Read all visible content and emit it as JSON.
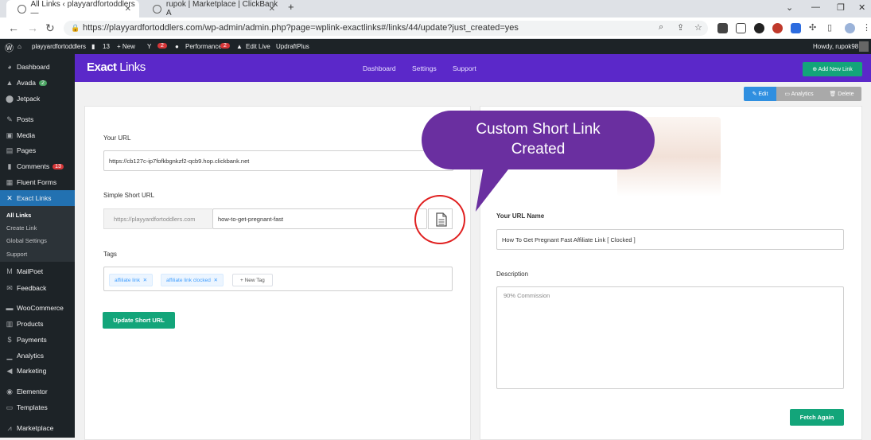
{
  "browser": {
    "tabs": [
      {
        "label": "All Links ‹ playyardfortoddlers —"
      },
      {
        "label": "rupok | Marketplace | ClickBank A"
      }
    ],
    "new_tab": "+",
    "url": "https://playyardfortoddlers.com/wp-admin/admin.php?page=wplink-exactlinks#/links/44/update?just_created=yes"
  },
  "wp_admin_bar": {
    "site": "playyardfortoddlers",
    "comments": "13",
    "new": "+ New",
    "yoast_badge": "2",
    "performance": "Performance",
    "performance_badge": "2",
    "edit_live": "Edit Live",
    "updraft": "UpdraftPlus",
    "howdy": "Howdy, rupok98"
  },
  "sidebar": {
    "items": [
      {
        "icon": "dashboard-icon",
        "label": "Dashboard"
      },
      {
        "icon": "avada-icon",
        "label": "Avada",
        "badge": "2"
      },
      {
        "icon": "jetpack-icon",
        "label": "Jetpack"
      },
      {
        "icon": "pin-icon",
        "label": "Posts"
      },
      {
        "icon": "media-icon",
        "label": "Media"
      },
      {
        "icon": "page-icon",
        "label": "Pages"
      },
      {
        "icon": "comments-icon",
        "label": "Comments",
        "badge": "13"
      },
      {
        "icon": "forms-icon",
        "label": "Fluent Forms"
      },
      {
        "icon": "link-icon",
        "label": "Exact Links"
      },
      {
        "icon": "mailpoet-icon",
        "label": "MailPoet"
      },
      {
        "icon": "feedback-icon",
        "label": "Feedback"
      },
      {
        "icon": "woocommerce-icon",
        "label": "WooCommerce"
      },
      {
        "icon": "products-icon",
        "label": "Products"
      },
      {
        "icon": "payments-icon",
        "label": "Payments"
      },
      {
        "icon": "analytics-icon",
        "label": "Analytics"
      },
      {
        "icon": "marketing-icon",
        "label": "Marketing"
      },
      {
        "icon": "elementor-icon",
        "label": "Elementor"
      },
      {
        "icon": "templates-icon",
        "label": "Templates"
      },
      {
        "icon": "marketplace-icon",
        "label": "Marketplace"
      }
    ],
    "submenu": [
      "All Links",
      "Create Link",
      "Global Settings",
      "Support"
    ]
  },
  "plugin": {
    "logo_bold": "Exact",
    "logo_light": " Links",
    "nav": [
      "Dashboard",
      "Settings",
      "Support"
    ],
    "add_new": "⊕ Add New Link",
    "actions": {
      "edit": "✎ Edit",
      "analytics": "▭ Analytics",
      "delete": "🗑 Delete"
    }
  },
  "form": {
    "your_url_label": "Your URL",
    "your_url_value": "https://cb127c-ip7fofkbgnkzf2-qcb9.hop.clickbank.net",
    "short_url_label": "Simple Short URL",
    "short_url_prefix": "https://playyardfortoddlers.com",
    "short_url_slug": "how-to-get-pregnant-fast",
    "tags_label": "Tags",
    "tags": [
      "affiliate link",
      "affiliate link clocked"
    ],
    "new_tag": "+ New Tag",
    "update_button": "Update Short URL",
    "url_name_label": "Your URL Name",
    "url_name_value": "How To Get Pregnant Fast Affiliate Link [ Clocked ]",
    "description_label": "Description",
    "description_value": "90% Commission",
    "fetch_button": "Fetch Again"
  },
  "callout": {
    "line1": "Custom Short Link",
    "line2": "Created"
  },
  "colors": {
    "purple": "#5b28c9",
    "green": "#13a57a",
    "wp_dark": "#1d2327",
    "wp_blue": "#2271b1",
    "callout": "#6a2fa0",
    "circle": "#e02020"
  }
}
